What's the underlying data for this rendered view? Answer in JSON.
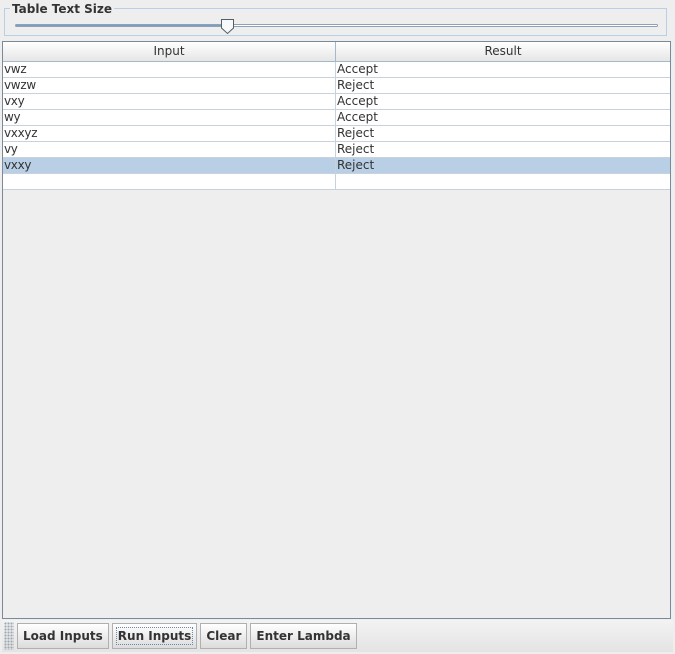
{
  "slider": {
    "legend": "Table Text Size",
    "value_fraction": 0.33
  },
  "table": {
    "headers": {
      "input": "Input",
      "result": "Result"
    },
    "rows": [
      {
        "input": "vwz",
        "result": "Accept"
      },
      {
        "input": "vwzw",
        "result": "Reject"
      },
      {
        "input": "vxy",
        "result": "Accept"
      },
      {
        "input": "wy",
        "result": "Accept"
      },
      {
        "input": "vxxyz",
        "result": "Reject"
      },
      {
        "input": "vy",
        "result": "Reject"
      },
      {
        "input": "vxxy",
        "result": "Reject"
      },
      {
        "input": "",
        "result": ""
      }
    ],
    "selected_row_index": 6
  },
  "toolbar": {
    "load_inputs": "Load Inputs",
    "run_inputs": "Run Inputs",
    "clear": "Clear",
    "enter_lambda": "Enter Lambda"
  },
  "colors": {
    "selection": "#b8cfe5",
    "background": "#eeeeee"
  }
}
